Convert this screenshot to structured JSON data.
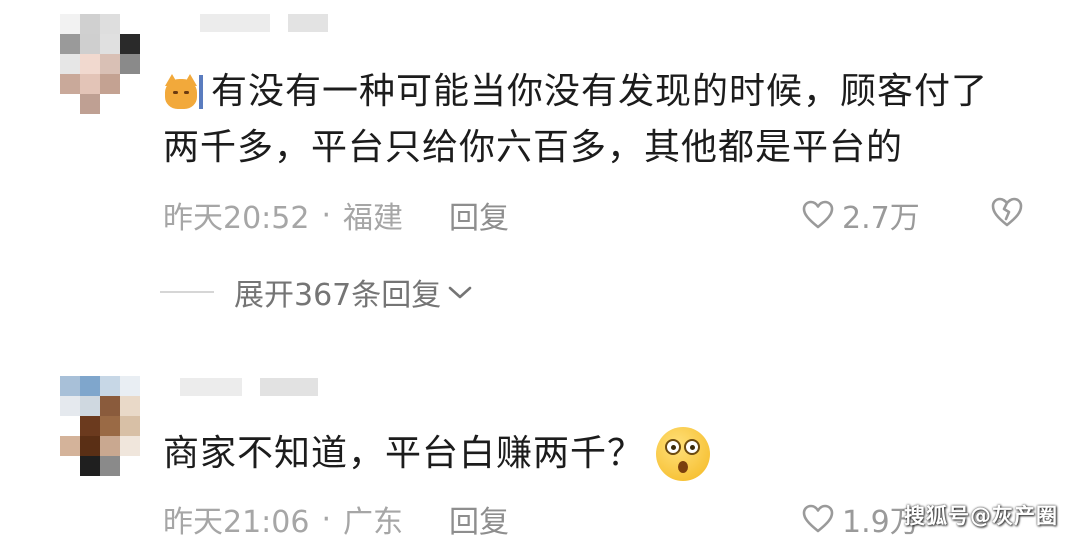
{
  "comments": [
    {
      "text_line1": "有没有一种可能当你没有发现的时候，顾客付了",
      "text_line2": "两千多，平台只给你六百多，其他都是平台的",
      "time": "昨天20:52",
      "separator": "·",
      "location": "福建",
      "reply_label": "回复",
      "like_count": "2.7万",
      "emoji_icon": "cat-emoji-icon",
      "expand_label": "展开367条回复"
    },
    {
      "text": "商家不知道，平台白赚两千？",
      "time": "昨天21:06",
      "separator": "·",
      "location": "广东",
      "reply_label": "回复",
      "like_count": "1.9万",
      "emoji_icon": "shocked-face-emoji-icon"
    }
  ],
  "watermark": "搜狐号@灰产圈",
  "colors": {
    "text": "#1c1c1c",
    "meta": "#a6a6a6",
    "background": "#ffffff"
  }
}
